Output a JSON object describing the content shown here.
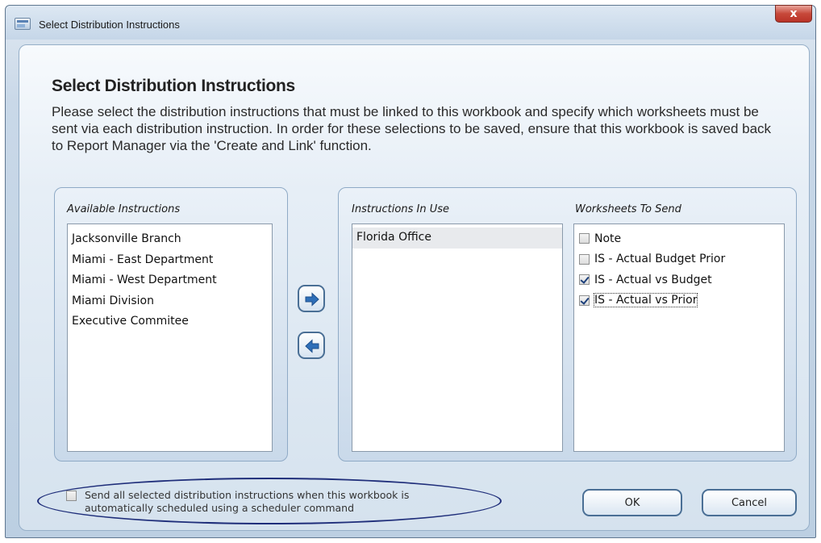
{
  "window": {
    "title": "Select Distribution Instructions",
    "close_symbol": "x"
  },
  "header": {
    "heading": "Select Distribution Instructions",
    "description": "Please select the distribution instructions that must be linked to this workbook and specify which worksheets must be sent via each distribution instruction. In order for these selections to be saved, ensure that this workbook is saved back to Report Manager via the 'Create and Link' function."
  },
  "available": {
    "label": "Available Instructions",
    "items": [
      "Jacksonville Branch",
      "Miami - East Department",
      "Miami - West Department",
      "Miami Division",
      "Executive Commitee"
    ]
  },
  "in_use": {
    "label": "Instructions In Use",
    "items": [
      "Florida Office"
    ]
  },
  "worksheets": {
    "label": "Worksheets To Send",
    "items": [
      {
        "label": "Note",
        "checked": false
      },
      {
        "label": "IS - Actual Budget Prior",
        "checked": false
      },
      {
        "label": "IS - Actual vs Budget",
        "checked": true
      },
      {
        "label": "IS - Actual vs Prior",
        "checked": true
      }
    ]
  },
  "move": {
    "add_icon": "arrow-right-icon",
    "remove_icon": "arrow-left-icon"
  },
  "footer": {
    "schedule_option_label": "Send all selected distribution instructions when this workbook is automatically scheduled using a scheduler command",
    "schedule_option_checked": false,
    "ok_label": "OK",
    "cancel_label": "Cancel"
  },
  "colors": {
    "accent": "#4a6f95",
    "highlight_outline": "#1f2e7a",
    "arrow_fill": "#2f6fb8",
    "close_red": "#c7483a"
  }
}
